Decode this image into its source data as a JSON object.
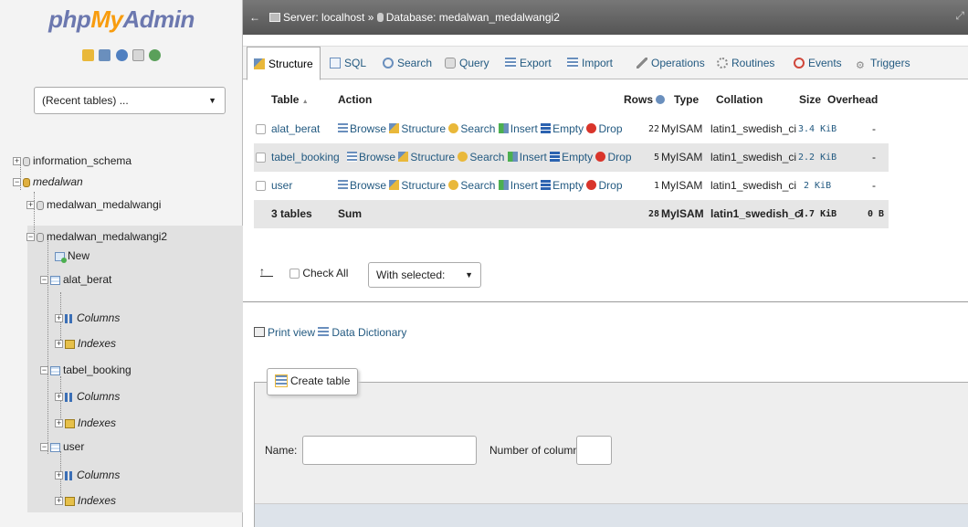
{
  "logo": {
    "php": "php",
    "my": "My",
    "admin": "Admin"
  },
  "nav": {
    "recent_tables": "(Recent tables) ...",
    "icons": [
      "home-icon",
      "exit-icon",
      "help-icon",
      "docs-icon",
      "reload-icon"
    ],
    "tree": {
      "information_schema": "information_schema",
      "medalwan": "medalwan",
      "medalwan_medalwangi": "medalwan_medalwangi",
      "medalwan_medalwangi2": "medalwan_medalwangi2",
      "new": "New",
      "tables": [
        {
          "name": "alat_berat",
          "columns": "Columns",
          "indexes": "Indexes"
        },
        {
          "name": "tabel_booking",
          "columns": "Columns",
          "indexes": "Indexes"
        },
        {
          "name": "user",
          "columns": "Columns",
          "indexes": "Indexes"
        }
      ]
    }
  },
  "breadcrumb": {
    "collapse": "←",
    "server": "Server: localhost",
    "sep": "»",
    "database": "Database: medalwan_medalwangi2"
  },
  "tabs": [
    "Structure",
    "SQL",
    "Search",
    "Query",
    "Export",
    "Import",
    "Operations",
    "Routines",
    "Events",
    "Triggers"
  ],
  "table": {
    "headers": {
      "table": "Table",
      "sort": "▲",
      "action": "Action",
      "rows": "Rows",
      "type": "Type",
      "collation": "Collation",
      "size": "Size",
      "overhead": "Overhead"
    },
    "actions": [
      "Browse",
      "Structure",
      "Search",
      "Insert",
      "Empty",
      "Drop"
    ],
    "rows": [
      {
        "name": "alat_berat",
        "rows": "22",
        "type": "MyISAM",
        "collation": "latin1_swedish_ci",
        "size": "3.4 KiB",
        "overhead": "-"
      },
      {
        "name": "tabel_booking",
        "rows": "5",
        "type": "MyISAM",
        "collation": "latin1_swedish_ci",
        "size": "2.2 KiB",
        "overhead": "-"
      },
      {
        "name": "user",
        "rows": "1",
        "type": "MyISAM",
        "collation": "latin1_swedish_ci",
        "size": "2 KiB",
        "overhead": "-"
      }
    ],
    "summary": {
      "tables": "3 tables",
      "label": "Sum",
      "rows": "28",
      "type": "MyISAM",
      "collation": "latin1_swedish_ci",
      "size": "7.7 KiB",
      "overhead": "0 B"
    }
  },
  "footer": {
    "check_all": "Check All",
    "with_selected": "With selected:",
    "print_view": "Print view",
    "data_dictionary": "Data Dictionary"
  },
  "create": {
    "legend": "Create table",
    "name_label": "Name:",
    "num_label": "Number of columns:"
  },
  "colors": {
    "link": "#235a81",
    "topbar": "#666666",
    "logo_blue": "#6c78af",
    "logo_orange": "#f89c0e"
  }
}
